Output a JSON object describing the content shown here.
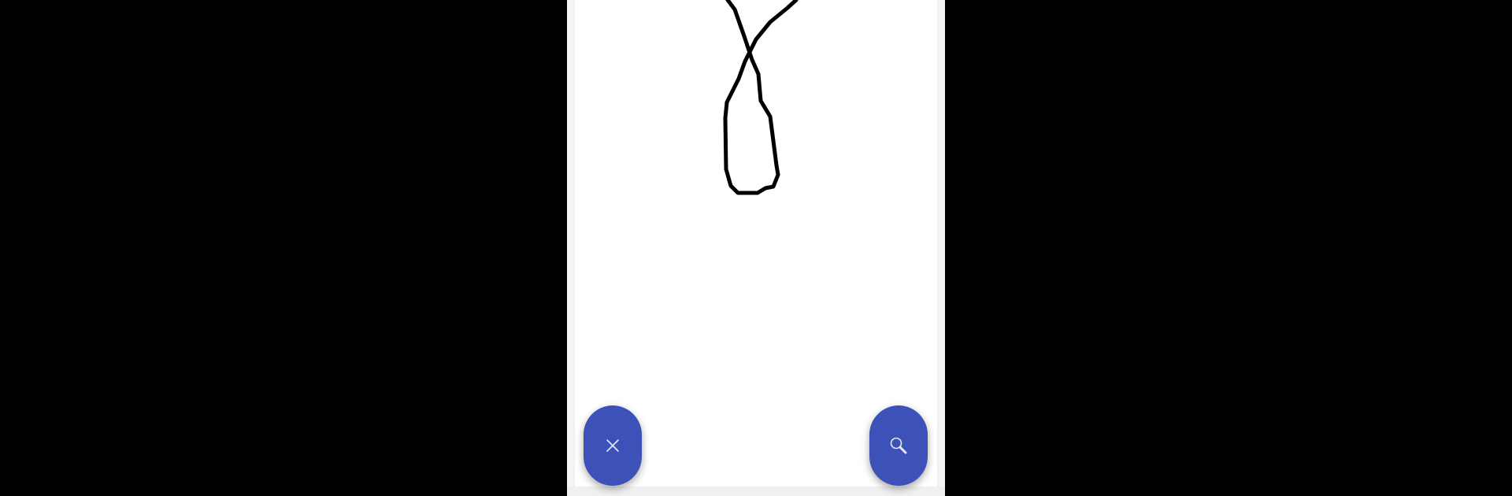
{
  "app": {
    "background_color": "#000000",
    "canvas_color": "#ffffff",
    "accent_color": "#3d52b8",
    "stroke_color": "#000000"
  },
  "buttons": {
    "clear": {
      "icon": "close-icon"
    },
    "search": {
      "icon": "search-icon"
    }
  }
}
